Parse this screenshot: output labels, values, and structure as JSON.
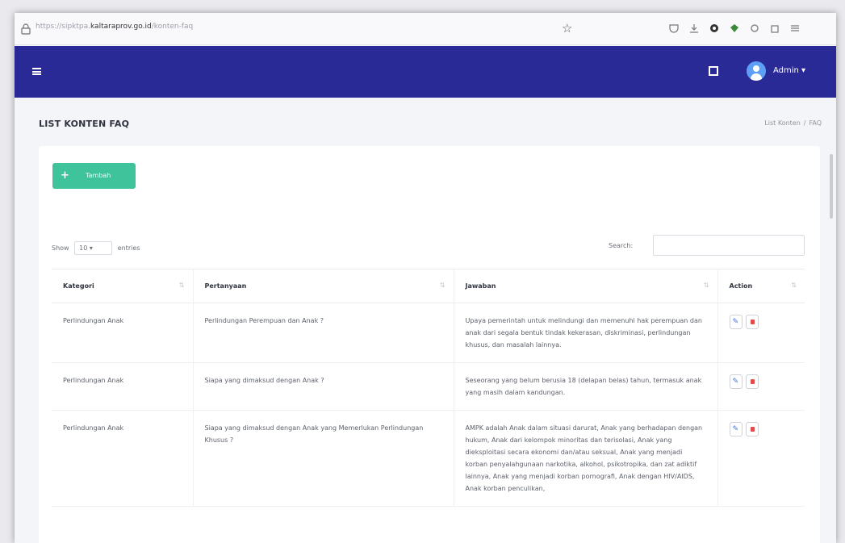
{
  "browser": {
    "url_prefix": "https://sipktpa.",
    "url_domain": "kaltaraprov.go.id",
    "url_path": "/konten-faq"
  },
  "navbar": {
    "user": "Admin"
  },
  "header": {
    "title": "LIST KONTEN FAQ",
    "breadcrumb": [
      "List Konten",
      "FAQ"
    ]
  },
  "toolbar": {
    "add_label": "Tambah"
  },
  "table_controls": {
    "show_label": "Show",
    "entries_value": "10",
    "entries_label": "entries",
    "search_label": "Search:"
  },
  "table": {
    "columns": [
      "Kategori",
      "Pertanyaan",
      "Jawaban",
      "Action"
    ],
    "rows": [
      {
        "kategori": "Perlindungan Anak",
        "pertanyaan": "Perlindungan Perempuan dan Anak ?",
        "jawaban": "Upaya pemerintah untuk melindungi dan memenuhi hak perempuan dan anak dari segala bentuk tindak kekerasan, diskriminasi, perlindungan khusus, dan masalah lainnya."
      },
      {
        "kategori": "Perlindungan Anak",
        "pertanyaan": "Siapa yang dimaksud dengan Anak ?",
        "jawaban": "Seseorang yang belum berusia 18 (delapan belas) tahun, termasuk anak yang masih dalam kandungan."
      },
      {
        "kategori": "Perlindungan Anak",
        "pertanyaan": "Siapa yang dimaksud dengan Anak yang Memerlukan Perlindungan Khusus ?",
        "jawaban": "AMPK adalah Anak dalam situasi darurat, Anak yang berhadapan dengan hukum, Anak dari kelompok minoritas dan terisolasi, Anak yang dieksploitasi secara ekonomi dan/atau seksual, Anak yang menjadi korban penyalahgunaan narkotika, alkohol, psikotropika, dan zat adiktif lainnya, Anak yang menjadi korban pornografi, Anak dengan HIV/AIDS, Anak korban penculikan,"
      }
    ]
  },
  "colors": {
    "navbar": "#2a2a96",
    "add_button": "#3fc39a",
    "delete": "#e04b4b",
    "edit": "#3d73d8"
  }
}
